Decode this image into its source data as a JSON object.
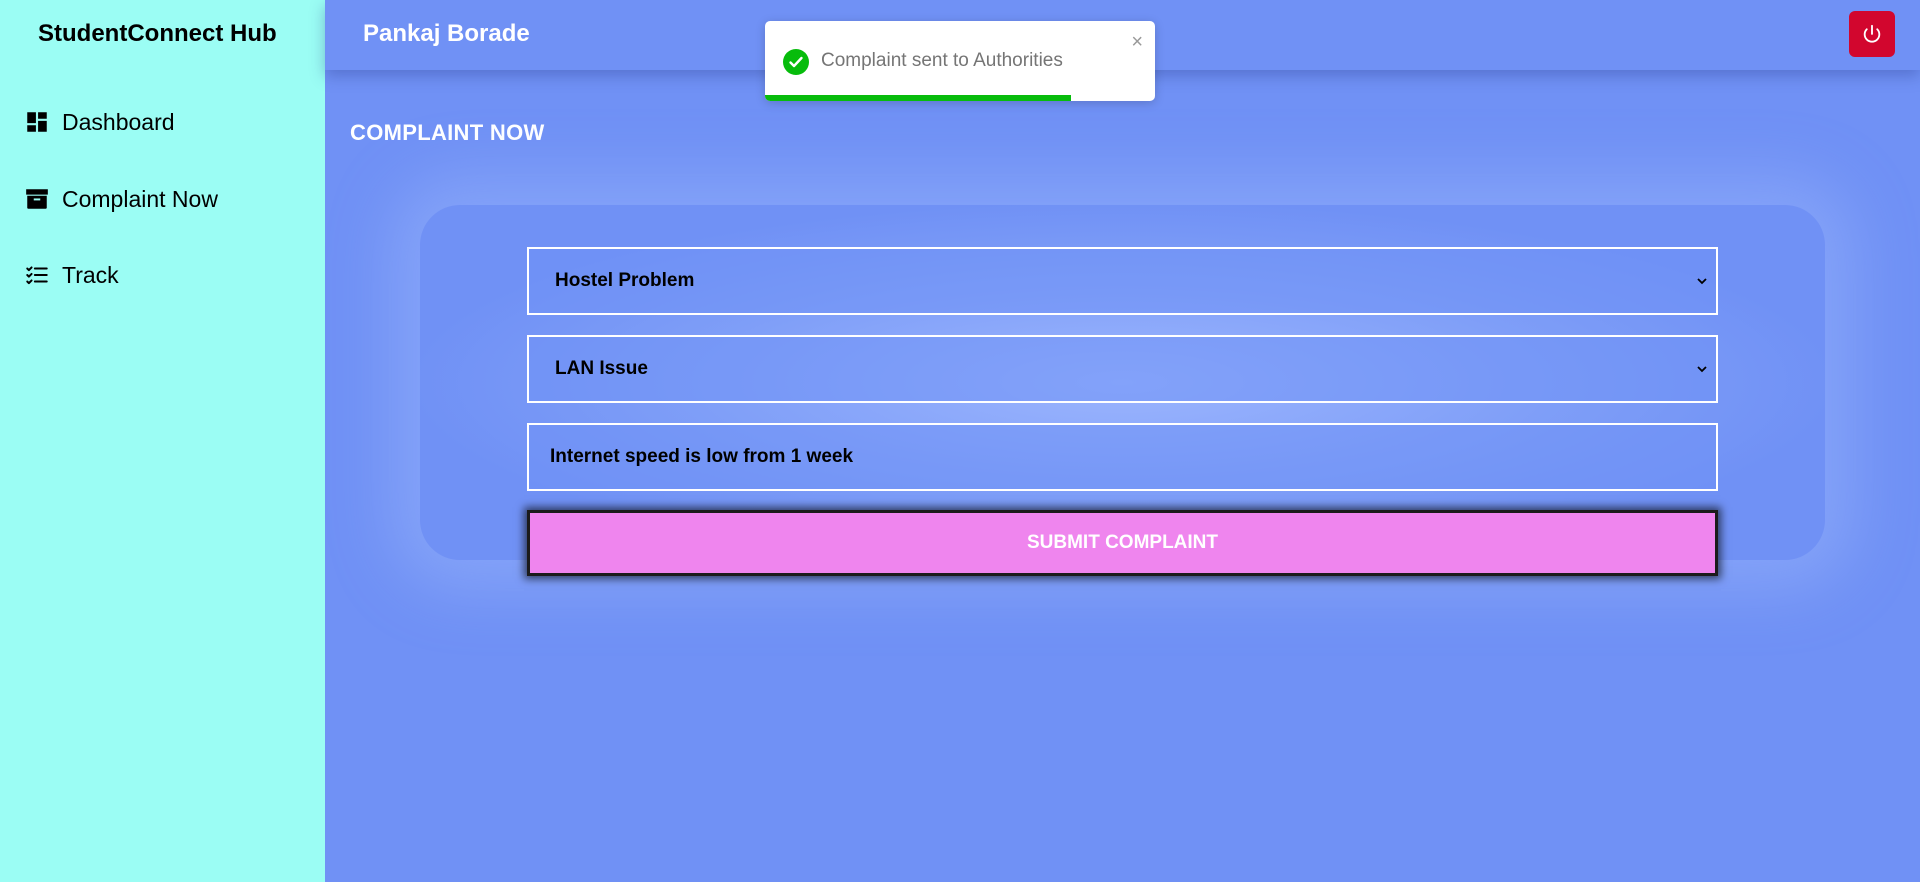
{
  "sidebar": {
    "brand": "StudentConnect Hub",
    "items": [
      {
        "label": "Dashboard",
        "icon": "dashboard-icon"
      },
      {
        "label": "Complaint Now",
        "icon": "archive-box-icon"
      },
      {
        "label": "Track",
        "icon": "checklist-icon"
      }
    ]
  },
  "header": {
    "user_name": "Pankaj Borade",
    "logout_icon": "power-icon"
  },
  "main": {
    "title": "COMPLAINT NOW",
    "category_select": {
      "value": "Hostel Problem"
    },
    "subcategory_select": {
      "value": "LAN Issue"
    },
    "description_input": {
      "value": "Internet speed is low from 1 week"
    },
    "submit_label": "SUBMIT COMPLAINT"
  },
  "toast": {
    "message": "Complaint sent to Authorities",
    "close_glyph": "×",
    "progress": 0.785,
    "icon": "check-circle-icon"
  },
  "colors": {
    "sidebar_bg": "#9bfdf4",
    "main_bg": "#7091f5",
    "logout_bg": "#d2062e",
    "submit_bg": "#ef85ee",
    "toast_success": "#07bc0c"
  }
}
